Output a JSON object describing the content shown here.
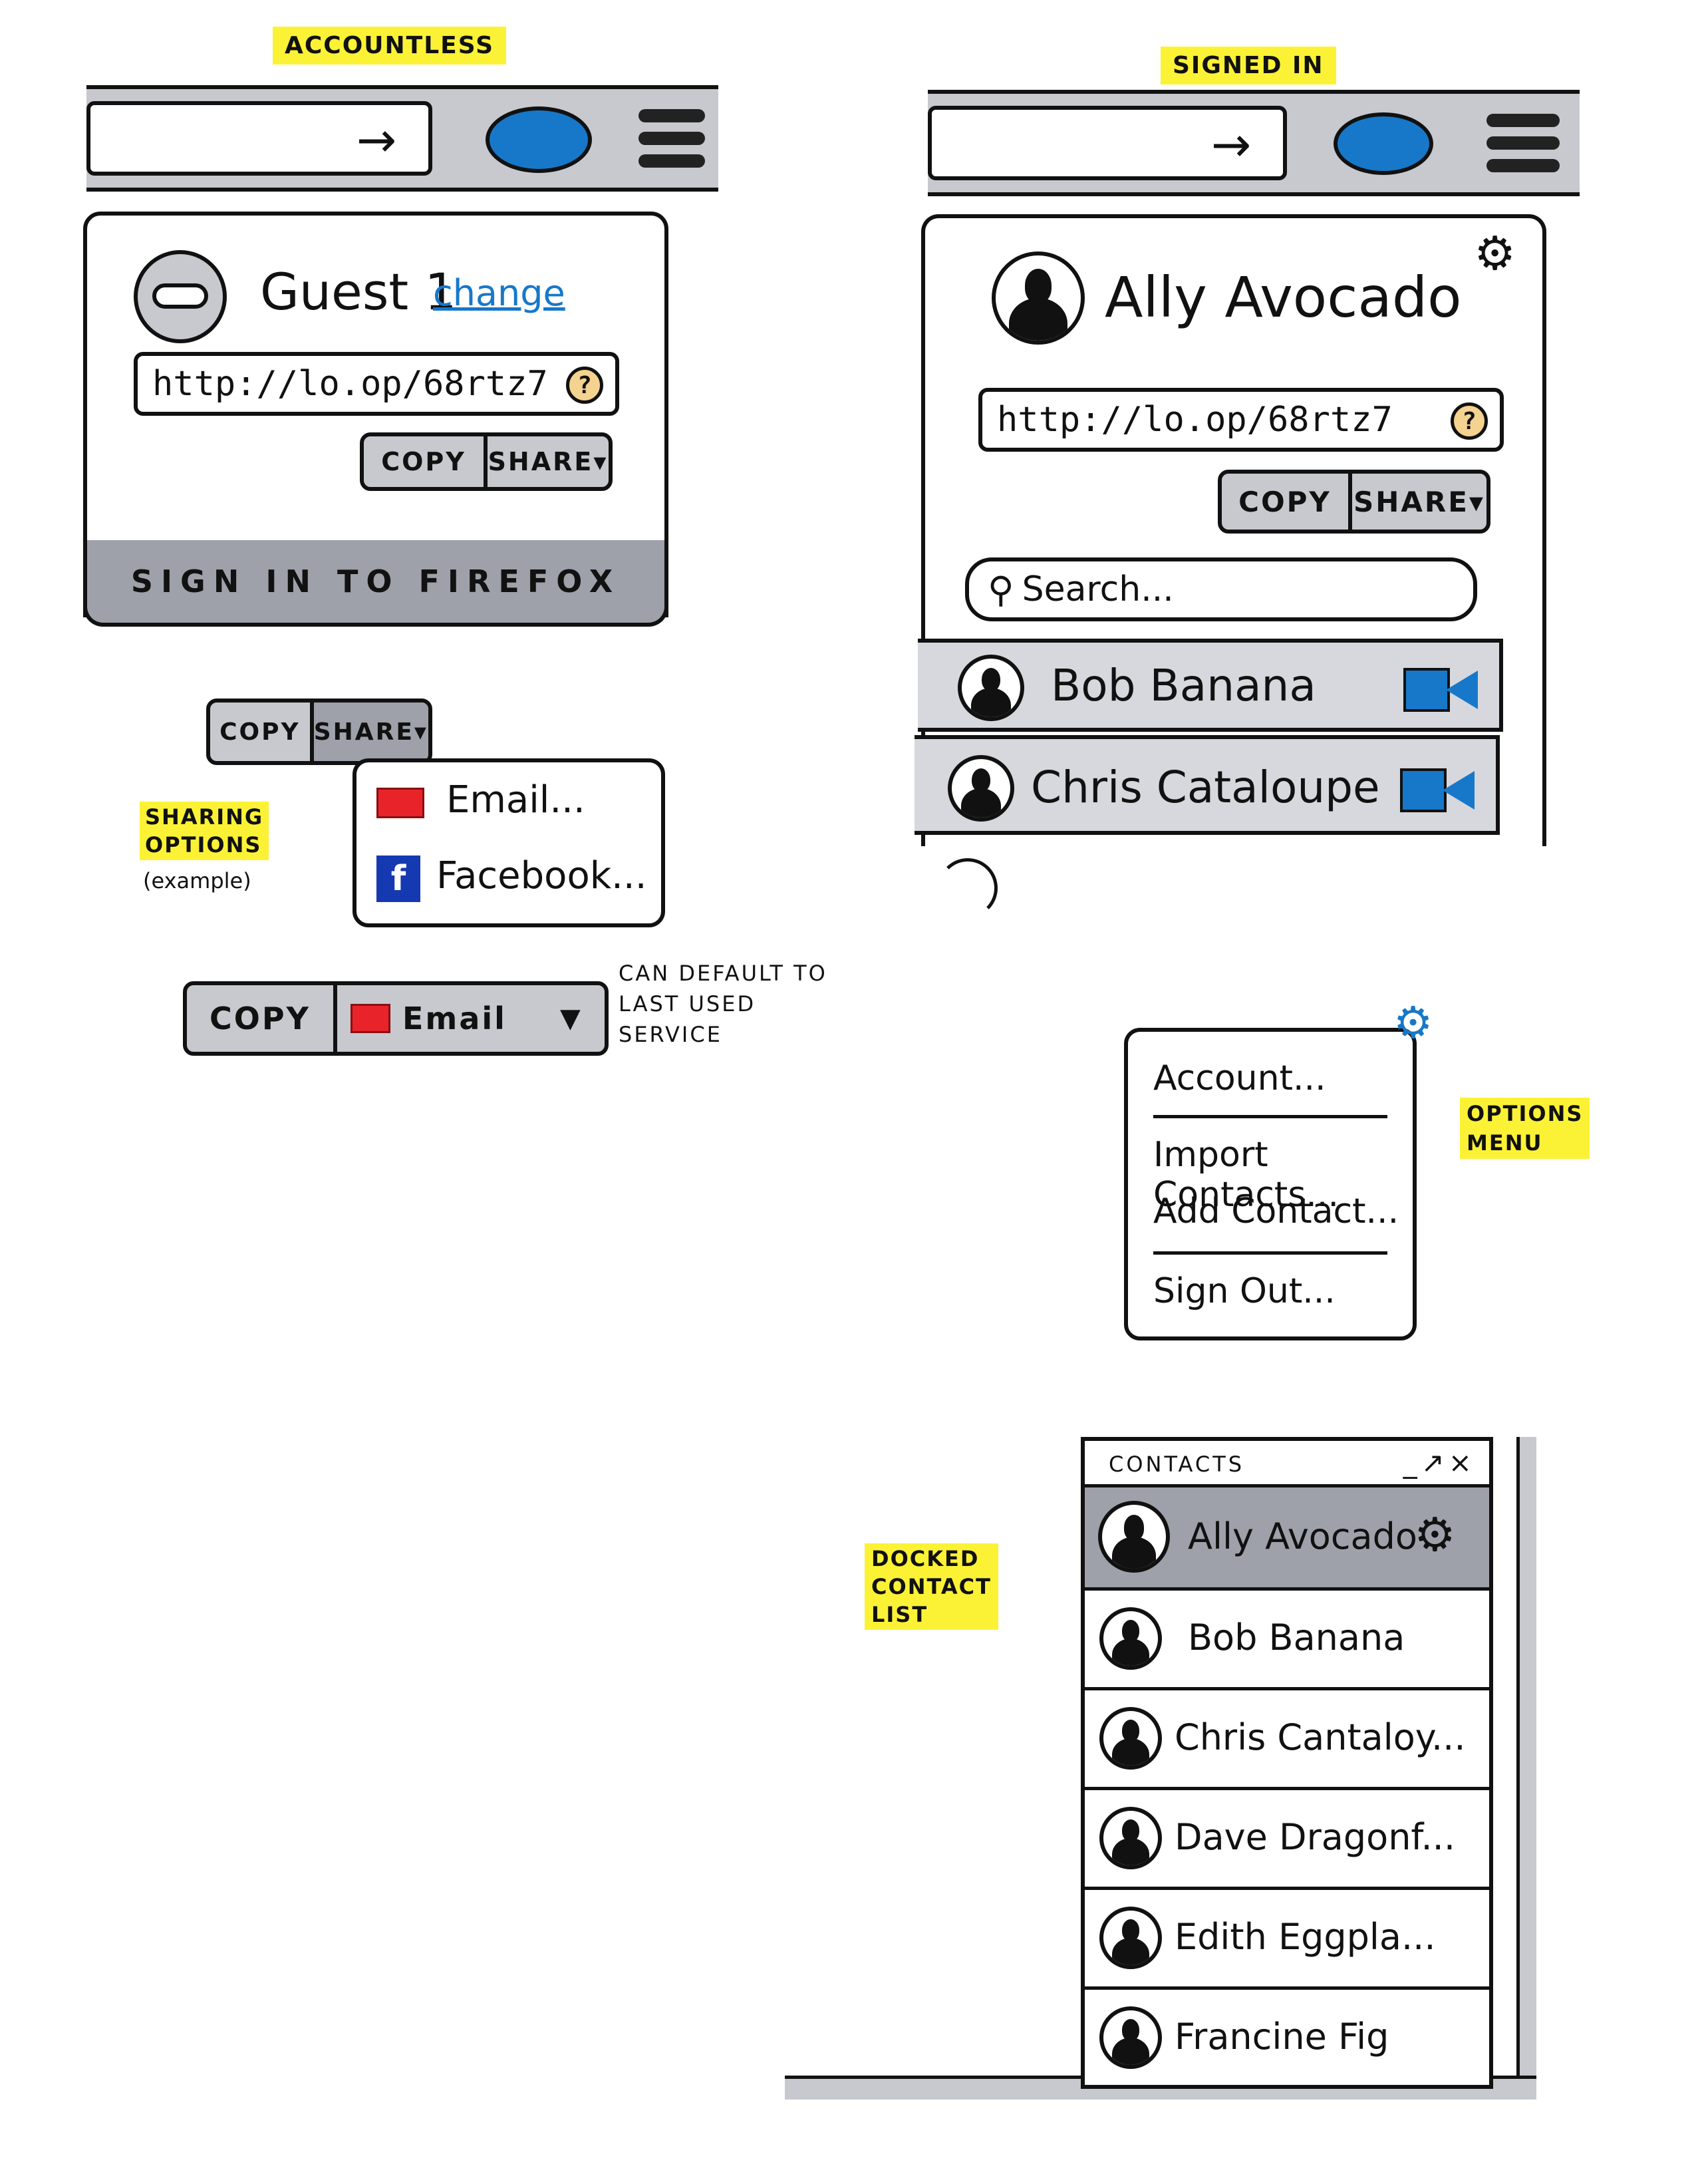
{
  "labels": {
    "accountless": "Accountless",
    "signed_in": "Signed in",
    "sharing_line1": "Sharing",
    "sharing_line2": "options",
    "sharing_line3": "(example)",
    "options_line1": "Options",
    "options_line2": "menu",
    "docked_line1": "Docked",
    "docked_line2": "contact",
    "docked_line3": "list"
  },
  "accountless_panel": {
    "guest_name": "Guest 1",
    "change_link": "change",
    "url": "http://lo.op/68rtz7",
    "help": "?",
    "copy": "COPY",
    "share": "SHARE▾",
    "sign_in": "Sign in to Firefox"
  },
  "signed_in_panel": {
    "user_name": "Ally Avocado",
    "url": "http://lo.op/68rtz7",
    "help": "?",
    "copy": "COPY",
    "share": "SHARE▾",
    "search_placeholder": "Search...",
    "contacts": [
      "Bob Banana",
      "Chris Cataloupe"
    ]
  },
  "share_example": {
    "copy": "COPY",
    "share": "SHARE▾",
    "menu_items": [
      "Email...",
      "Facebook..."
    ]
  },
  "default_share": {
    "copy": "COPY",
    "service": "Email",
    "note_line1": "Can default to",
    "note_line2": "last used",
    "note_line3": "service"
  },
  "options_menu": {
    "items": [
      "Account...",
      "Import Contacts...",
      "Add Contact...",
      "Sign Out..."
    ]
  },
  "docked_list": {
    "title": "Contacts",
    "controls": "_↗×",
    "contacts": [
      "Ally Avocado",
      "Bob Banana",
      "Chris Cantaloy...",
      "Dave Dragonf...",
      "Edith Eggpla...",
      "Francine Fig"
    ]
  },
  "colors": {
    "highlight": "#fbf236",
    "accent_blue": "#1778c9",
    "toolbar_gray": "#c7c9cf",
    "email_red": "#e8242a",
    "facebook_blue": "#1539b0",
    "help_tan": "#f4d28f"
  }
}
